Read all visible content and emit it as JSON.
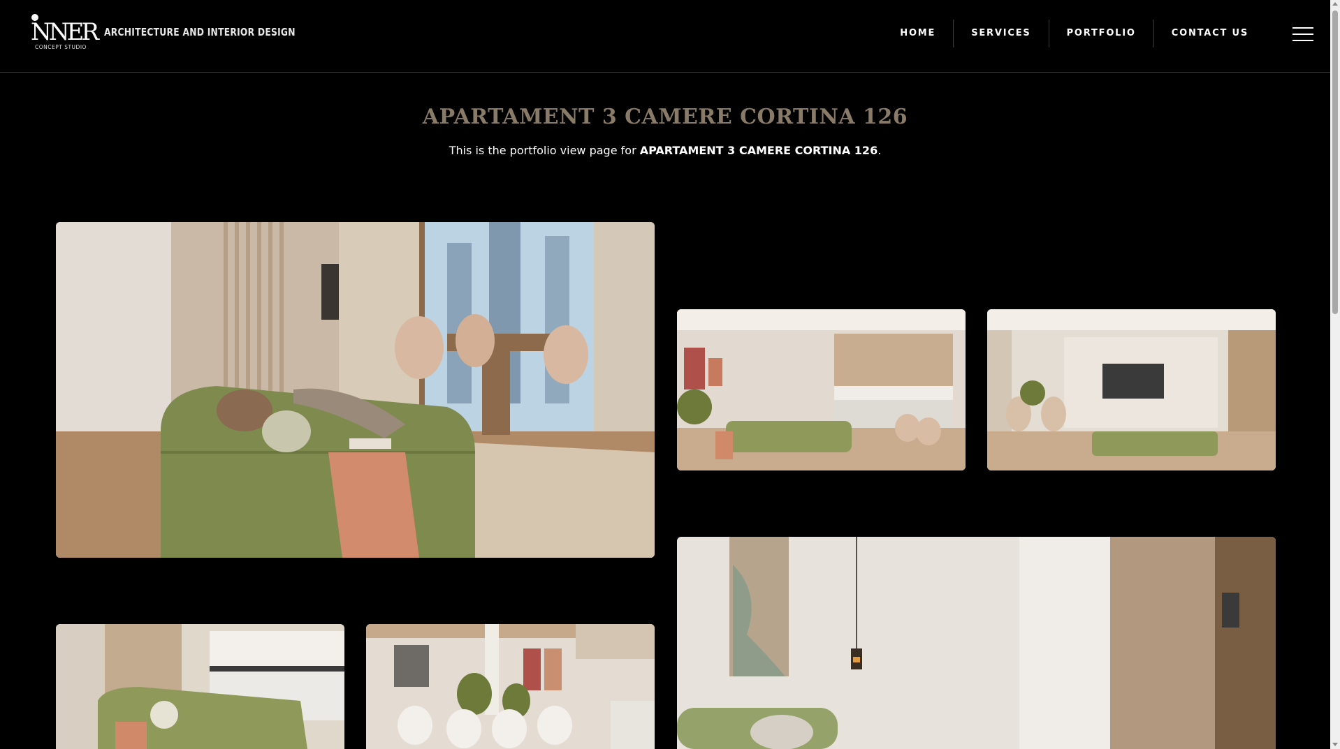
{
  "header": {
    "logo_word": "NNER",
    "logo_sub": "CONCEPT STUDIO",
    "tagline": "ARCHITECTURE AND INTERIOR DESIGN",
    "nav": [
      {
        "label": "HOME"
      },
      {
        "label": "SERVICES"
      },
      {
        "label": "PORTFOLIO"
      },
      {
        "label": "CONTACT US"
      }
    ]
  },
  "page": {
    "title": "APARTAMENT 3 CAMERE CORTINA 126",
    "desc_prefix": "This is the portfolio view page for ",
    "desc_bold": "APARTAMENT 3 CAMERE CORTINA 126",
    "desc_suffix": "."
  },
  "gallery": [
    {
      "icon": "photo-living-room-dining"
    },
    {
      "icon": "photo-living-kitchen"
    },
    {
      "icon": "photo-living-tv-wall"
    },
    {
      "icon": "photo-living-wall-art"
    },
    {
      "icon": "photo-sofa-kitchen"
    },
    {
      "icon": "photo-dining-table"
    }
  ]
}
